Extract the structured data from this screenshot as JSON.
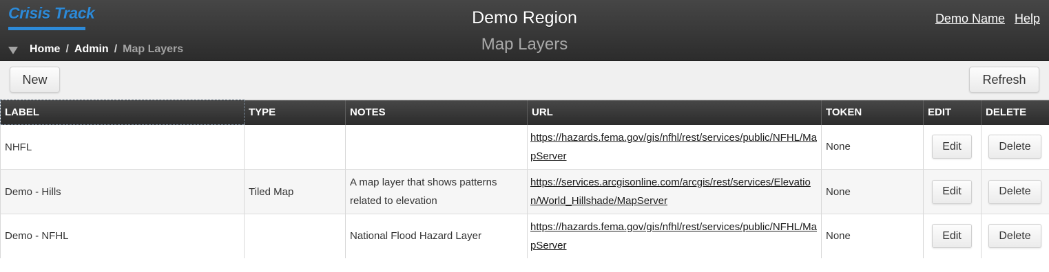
{
  "app": {
    "logo_text": "Crisis Track",
    "region": "Demo Region",
    "page_title": "Map Layers",
    "brand_color": "#2d8ad8"
  },
  "user_links": {
    "user_name": "Demo Name",
    "help": "Help"
  },
  "breadcrumb": {
    "home": "Home",
    "admin": "Admin",
    "current": "Map Layers",
    "separator": "/"
  },
  "toolbar": {
    "new_label": "New",
    "refresh_label": "Refresh"
  },
  "table": {
    "headers": {
      "label": "LABEL",
      "type": "TYPE",
      "notes": "NOTES",
      "url": "URL",
      "token": "TOKEN",
      "edit": "EDIT",
      "delete": "DELETE"
    },
    "rows": [
      {
        "label": "NHFL",
        "type": "",
        "notes": "",
        "url": "https://hazards.fema.gov/gis/nfhl/rest/services/public/NFHL/MapServer",
        "token": "None",
        "edit_label": "Edit",
        "delete_label": "Delete"
      },
      {
        "label": "Demo - Hills",
        "type": "Tiled Map",
        "notes": "A map layer that shows patterns related to elevation",
        "url": "https://services.arcgisonline.com/arcgis/rest/services/Elevation/World_Hillshade/MapServer",
        "token": "None",
        "edit_label": "Edit",
        "delete_label": "Delete"
      },
      {
        "label": "Demo - NFHL",
        "type": "",
        "notes": "National Flood Hazard Layer",
        "url": "https://hazards.fema.gov/gis/nfhl/rest/services/public/NFHL/MapServer",
        "token": "None",
        "edit_label": "Edit",
        "delete_label": "Delete"
      }
    ]
  },
  "icons": {
    "breadcrumb_toggle": "triangle-down-icon"
  }
}
